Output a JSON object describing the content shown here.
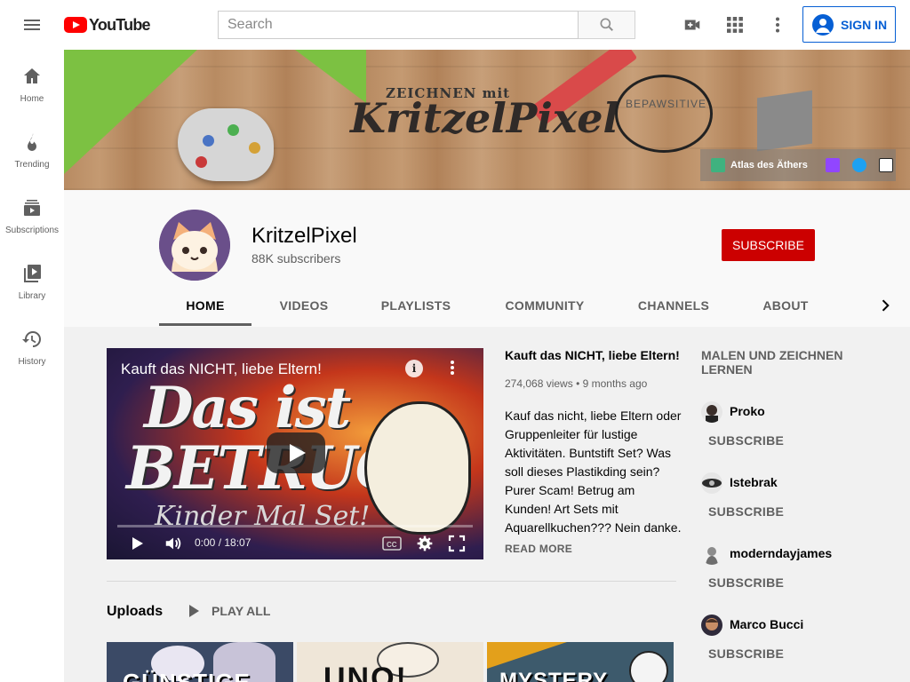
{
  "header": {
    "logo_text": "YouTube",
    "search_placeholder": "Search",
    "sign_in_label": "SIGN IN"
  },
  "sidebar": {
    "items": [
      {
        "label": "Home",
        "icon": "home-icon"
      },
      {
        "label": "Trending",
        "icon": "trending-icon"
      },
      {
        "label": "Subscriptions",
        "icon": "subscriptions-icon"
      },
      {
        "label": "Library",
        "icon": "library-icon"
      },
      {
        "label": "History",
        "icon": "history-icon"
      }
    ]
  },
  "banner": {
    "small_title": "ZEICHNEN mit",
    "large_title": "KritzelPixel",
    "bubble_text": "BEPAWSITIVE",
    "link_label": "Atlas des Äthers",
    "link_icons": [
      "twitch-icon",
      "twitter-icon",
      "amazon-icon"
    ]
  },
  "channel": {
    "name": "KritzelPixel",
    "subscribers": "88K subscribers",
    "subscribe_label": "SUBSCRIBE",
    "tabs": [
      "HOME",
      "VIDEOS",
      "PLAYLISTS",
      "COMMUNITY",
      "CHANNELS",
      "ABOUT"
    ],
    "active_tab": "HOME"
  },
  "featured_video": {
    "player_title": "Kauft das NICHT, liebe Eltern!",
    "thumbnail_line1": "Das ist",
    "thumbnail_line2": "BETRUG!",
    "thumbnail_line3": "Kinder Mal Set!",
    "time": "0:00 / 18:07",
    "title": "Kauft das NICHT, liebe Eltern!",
    "views": "274,068 views",
    "age": "9 months ago",
    "description": "Kauf das nicht, liebe Eltern oder Gruppenleiter für lustige Aktivitäten. Buntstift Set? Was soll dieses Plastikding sein? Purer Scam! Betrug am Kunden! Art Sets mit Aquarellkuchen??? Nein danke.",
    "read_more": "READ MORE"
  },
  "uploads": {
    "title": "Uploads",
    "play_all": "PLAY ALL",
    "thumbnails": [
      {
        "caption": "GÜNSTIGE"
      },
      {
        "caption": "UNO!"
      },
      {
        "caption": "MYSTERY"
      }
    ]
  },
  "related_channels": {
    "title": "MALEN UND ZEICHNEN LERNEN",
    "subscribe_label": "SUBSCRIBE",
    "channels": [
      {
        "name": "Proko",
        "color": "#3a2e2a"
      },
      {
        "name": "Istebrak",
        "color": "#2b2b2b"
      },
      {
        "name": "moderndayjames",
        "color": "#8c8c8c"
      },
      {
        "name": "Marco Bucci",
        "color": "#4a3226"
      }
    ]
  },
  "colors": {
    "accent_red": "#cc0000",
    "link_blue": "#065fd4"
  }
}
